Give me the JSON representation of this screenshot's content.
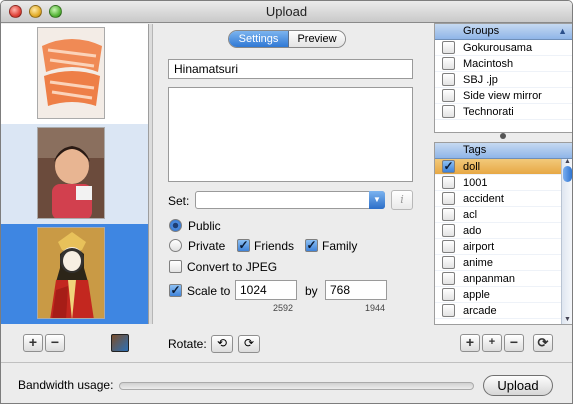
{
  "window": {
    "title": "Upload"
  },
  "photos": [
    {
      "name": "salmon",
      "selected": false
    },
    {
      "name": "child",
      "selected": false
    },
    {
      "name": "hina-doll",
      "selected": true
    }
  ],
  "tabs": {
    "settings": "Settings",
    "preview": "Preview",
    "active": "Settings"
  },
  "photo_title": "Hinamatsuri",
  "description": "",
  "set": {
    "label": "Set:",
    "value": ""
  },
  "privacy": {
    "public_label": "Public",
    "private_label": "Private",
    "friends_label": "Friends",
    "family_label": "Family",
    "selected": "Public",
    "friends_checked": true,
    "family_checked": true
  },
  "convert_jpeg": {
    "label": "Convert to JPEG",
    "checked": false
  },
  "scale": {
    "label": "Scale to",
    "checked": true,
    "width": "1024",
    "by_label": "by",
    "height": "768",
    "orig_width": "2592",
    "orig_height": "1944"
  },
  "rotate_label": "Rotate:",
  "groups": {
    "header": "Groups",
    "items": [
      "Gokurousama",
      "Macintosh",
      "SBJ .jp",
      "Side view mirror",
      "Technorati"
    ]
  },
  "tags": {
    "header": "Tags",
    "items": [
      "doll",
      "1001",
      "accident",
      "acl",
      "ado",
      "airport",
      "anime",
      "anpanman",
      "apple",
      "arcade"
    ],
    "checked": [
      "doll"
    ],
    "selected": "doll"
  },
  "bandwidth_label": "Bandwidth usage:",
  "upload_button": "Upload",
  "icons": {
    "add": "+",
    "remove": "−",
    "uploader": "uploader-app-icon",
    "info": "i",
    "rotate_left": "⟲",
    "rotate_right": "⟳",
    "refresh": "⟳",
    "add_tag": "+",
    "add_tag_alt": "+"
  },
  "colors": {
    "accent": "#3e86e2",
    "selected_row": "#e7a845"
  }
}
